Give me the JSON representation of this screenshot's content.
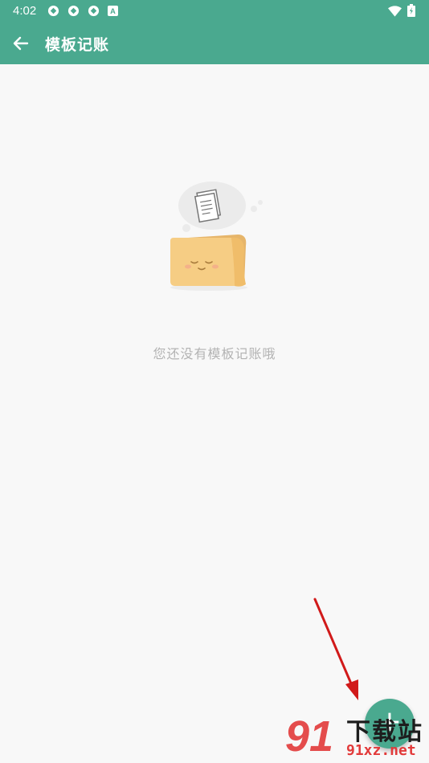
{
  "status_bar": {
    "time": "4:02",
    "icons": [
      "sync-icon",
      "sync-icon",
      "sync-icon",
      "a-badge-icon",
      "wifi-icon",
      "battery-icon"
    ]
  },
  "app_bar": {
    "title": "模板记账",
    "back_icon": "arrow-left-icon"
  },
  "empty_state": {
    "message": "您还没有模板记账哦",
    "illustration": "sleepy-folder-with-document"
  },
  "fab": {
    "label": "+"
  },
  "watermark": {
    "logo": "91",
    "title": "下载站",
    "url": "91xz.net"
  },
  "colors": {
    "primary": "#4aa98f",
    "background": "#f8f8f8",
    "empty_text": "#b3b3b3",
    "folder": "#f6cd84",
    "annotation_arrow": "#d11a1a"
  }
}
